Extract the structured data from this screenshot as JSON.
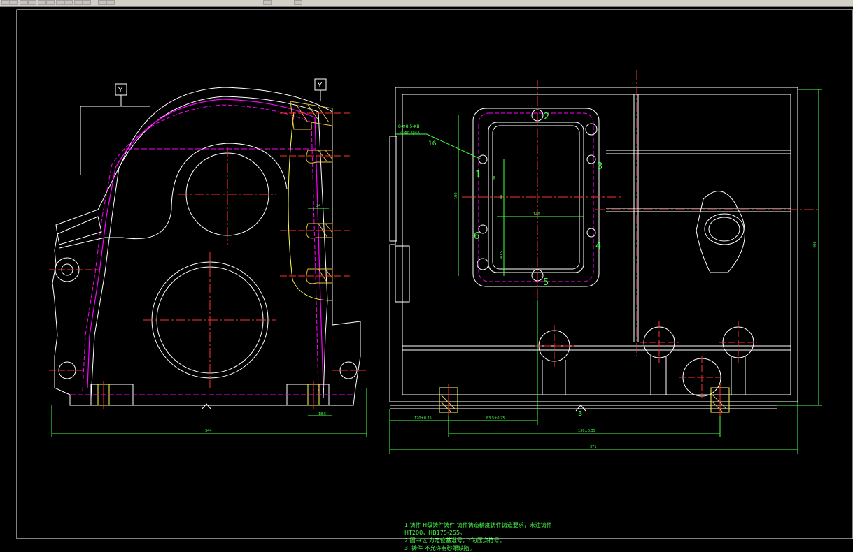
{
  "toolbar": {
    "buttons": [
      "new-icon",
      "open-icon",
      "save-icon",
      "print-icon",
      "preview-icon",
      "cut-icon",
      "copy-icon",
      "paste-icon",
      "undo-icon",
      "redo-icon",
      "pan-icon",
      "zoom-icon",
      "properties-icon",
      "help-icon"
    ]
  },
  "left_view": {
    "datum_left": "Y",
    "datum_right": "Y",
    "dim_rib": "24",
    "dim_foot": "18.5",
    "dim_total": "344"
  },
  "right_view": {
    "hole_callout": "8-Φ8.5-KB",
    "hole_tolerance": "⊕|Φ0.6|ⓂA",
    "callout_num": "16",
    "dim_height": "406",
    "dim_cover_v1": "100",
    "dim_cover_v2": "30",
    "dim_cover_v3": "88",
    "dim_cover_v4": "40.5",
    "dim_cover_h": "140",
    "dim_b1": "120±0.25",
    "dim_b2": "83.5±0.25",
    "dim_b3": "130±0.35",
    "dim_total": "371",
    "section_mark": "3",
    "labels": [
      "1",
      "2",
      "3",
      "4",
      "5",
      "6"
    ]
  },
  "notes": {
    "line1": "1.铸件 H级铸件铸件 铸件铸造精度铸件铸造要求，未注铸件",
    "line2": "HT200，HB175-255。",
    "line3": "2.图中 △ 为定位基准号，Y为压点符号。",
    "line4": "3. 铸件 不允许有砂眼缺陷。"
  },
  "colors": {
    "white": "#ffffff",
    "magenta": "#ff00ff",
    "red": "#ff3030",
    "green": "#46ff46",
    "yellow": "#ffff50",
    "hatch": "#e8c040"
  }
}
